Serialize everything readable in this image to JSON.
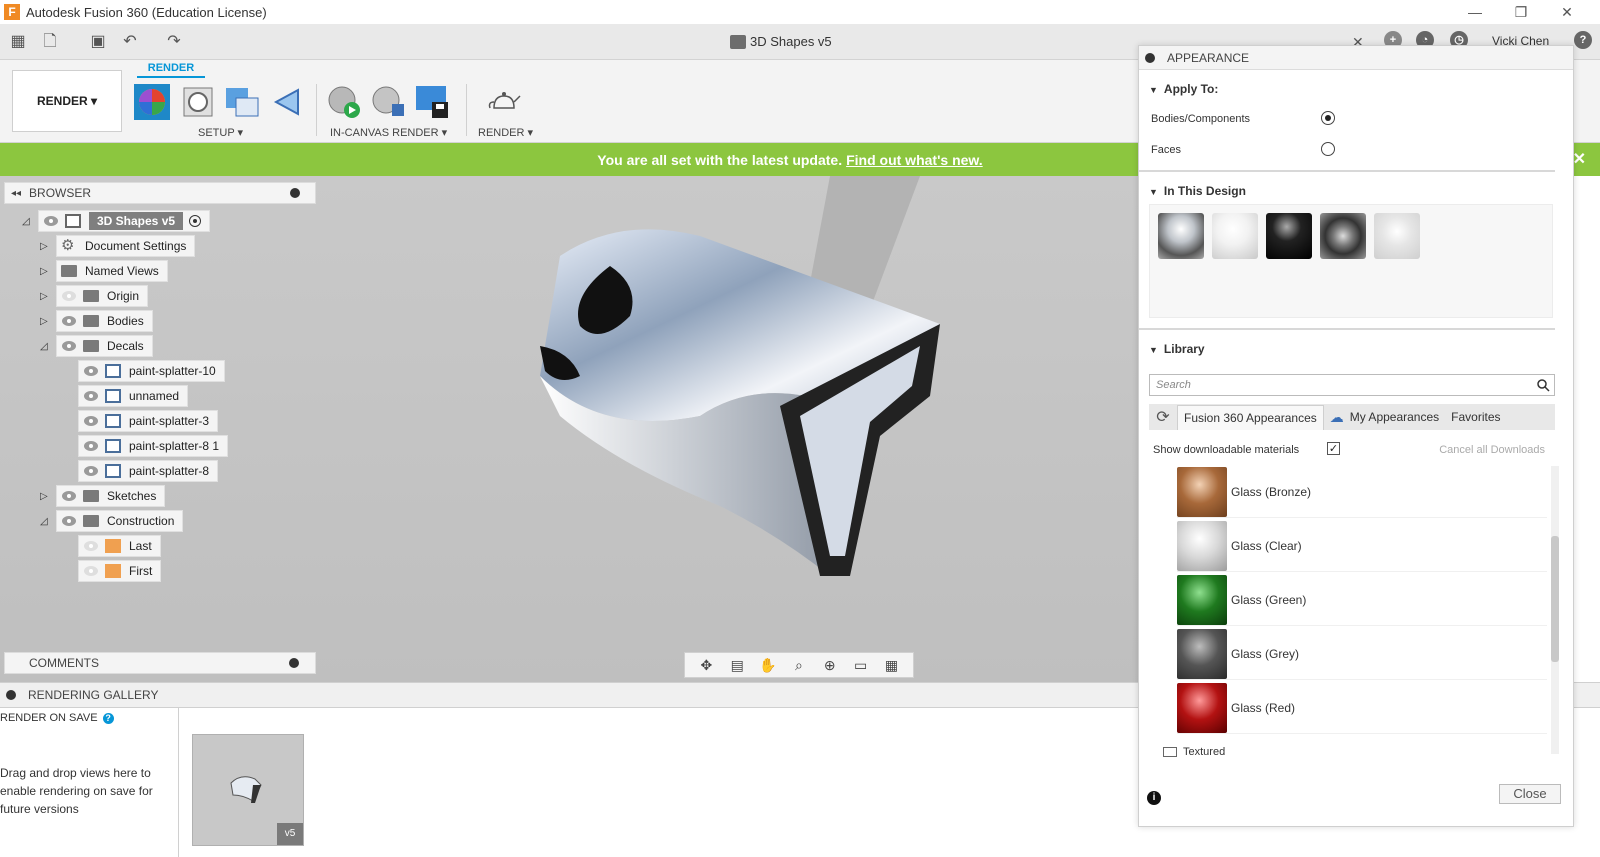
{
  "app": {
    "title": "Autodesk Fusion 360 (Education License)",
    "logo_letter": "F"
  },
  "window": {
    "minimize": "—",
    "restore": "❐",
    "close": "✕"
  },
  "document": {
    "tab_title": "3D Shapes v5",
    "close": "✕"
  },
  "user": {
    "name": "Vicki Chen"
  },
  "ribbon": {
    "workspace": "RENDER ▾",
    "active_tab": "RENDER",
    "groups": {
      "setup": "SETUP ▾",
      "in_canvas": "IN-CANVAS RENDER ▾",
      "render": "RENDER ▾"
    }
  },
  "banner": {
    "text": "You are all set with the latest update.",
    "link": "Find out what's new.",
    "close": "✕"
  },
  "browser": {
    "title": "BROWSER",
    "root": "3D Shapes v5",
    "items": [
      {
        "label": "Document Settings"
      },
      {
        "label": "Named Views"
      },
      {
        "label": "Origin"
      },
      {
        "label": "Bodies"
      },
      {
        "label": "Decals"
      },
      {
        "label": "paint-splatter-10"
      },
      {
        "label": "unnamed"
      },
      {
        "label": "paint-splatter-3"
      },
      {
        "label": "paint-splatter-8 1"
      },
      {
        "label": "paint-splatter-8"
      },
      {
        "label": "Sketches"
      },
      {
        "label": "Construction"
      },
      {
        "label": "Last"
      },
      {
        "label": "First"
      }
    ]
  },
  "comments": {
    "title": "COMMENTS"
  },
  "gallery": {
    "title": "RENDERING GALLERY",
    "render_on_save": "RENDER ON SAVE",
    "hint": "Drag and drop views here to enable rendering on save for future versions",
    "thumb_badge": "v5"
  },
  "appearance": {
    "title": "APPEARANCE",
    "apply_to": {
      "title": "Apply To:",
      "options": [
        {
          "label": "Bodies/Components",
          "selected": true
        },
        {
          "label": "Faces",
          "selected": false
        }
      ]
    },
    "in_this_design": {
      "title": "In This Design"
    },
    "library": {
      "title": "Library",
      "search_placeholder": "Search",
      "tabs": [
        "Fusion 360 Appearances",
        "My Appearances",
        "Favorites"
      ],
      "show_downloadable": "Show downloadable materials",
      "show_downloadable_checked": true,
      "cancel_downloads": "Cancel all Downloads",
      "materials": [
        {
          "label": "Glass (Bronze)",
          "color": "#a8693a"
        },
        {
          "label": "Glass (Clear)",
          "color": "#d8d8d8"
        },
        {
          "label": "Glass (Green)",
          "color": "#1f7a1f"
        },
        {
          "label": "Glass (Grey)",
          "color": "#555555"
        },
        {
          "label": "Glass (Red)",
          "color": "#b31212"
        }
      ],
      "folder": "Textured"
    },
    "close": "Close"
  },
  "colors": {
    "accent": "#0696d7",
    "banner": "#8cc63f"
  }
}
